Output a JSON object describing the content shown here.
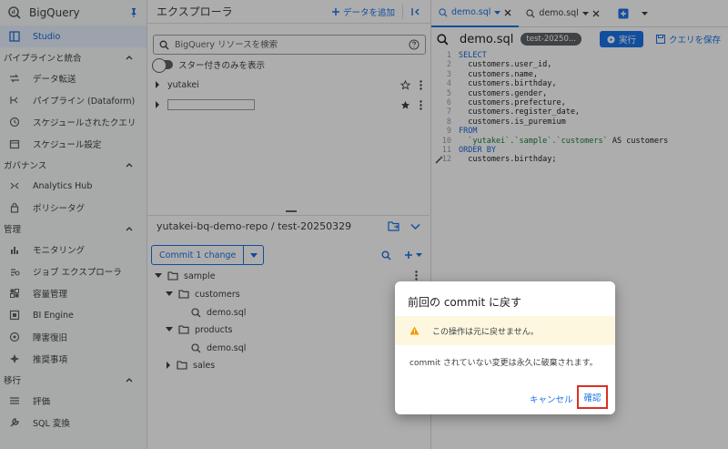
{
  "app": {
    "name": "BigQuery"
  },
  "left_nav": {
    "studio": "Studio",
    "sections": [
      {
        "title": "パイプラインと統合",
        "items": [
          "データ転送",
          "パイプライン (Dataform)",
          "スケジュールされたクエリ",
          "スケジュール設定"
        ]
      },
      {
        "title": "ガバナンス",
        "items": [
          "Analytics Hub",
          "ポリシータグ"
        ]
      },
      {
        "title": "管理",
        "items": [
          "モニタリング",
          "ジョブ エクスプローラ",
          "容量管理",
          "BI Engine",
          "障害復旧",
          "推奨事項"
        ]
      },
      {
        "title": "移行",
        "items": [
          "評価",
          "SQL 変換"
        ]
      }
    ]
  },
  "explorer": {
    "title": "エクスプローラ",
    "add_data": "データを追加",
    "search_placeholder": "BigQuery リソースを検索",
    "starred_only": "スター付きのみを表示",
    "projects": [
      "yutakei",
      ""
    ]
  },
  "repo": {
    "title": "yutakei-bq-demo-repo / test-20250329",
    "commit_button": "Commit 1 change",
    "tree": [
      {
        "label": "sample",
        "type": "folder"
      },
      {
        "label": "customers",
        "type": "folder"
      },
      {
        "label": "demo.sql",
        "type": "file"
      },
      {
        "label": "products",
        "type": "folder"
      },
      {
        "label": "demo.sql",
        "type": "file"
      },
      {
        "label": "sales",
        "type": "folder"
      }
    ]
  },
  "editor": {
    "tabs": [
      "demo.sql",
      "demo.sql"
    ],
    "query_name": "demo.sql",
    "branch_badge": "test-20250...",
    "run": "実行",
    "save": "クエリを保存",
    "lines": [
      {
        "n": "1",
        "parts": [
          {
            "t": "SELECT",
            "c": "kw"
          }
        ]
      },
      {
        "n": "2",
        "parts": [
          {
            "t": "  customers.user_id,",
            "c": ""
          }
        ]
      },
      {
        "n": "3",
        "parts": [
          {
            "t": "  customers.name,",
            "c": ""
          }
        ]
      },
      {
        "n": "4",
        "parts": [
          {
            "t": "  customers.birthday,",
            "c": ""
          }
        ]
      },
      {
        "n": "5",
        "parts": [
          {
            "t": "  customers.gender,",
            "c": ""
          }
        ]
      },
      {
        "n": "6",
        "parts": [
          {
            "t": "  customers.prefecture,",
            "c": ""
          }
        ]
      },
      {
        "n": "7",
        "parts": [
          {
            "t": "  customers.register_date,",
            "c": ""
          }
        ]
      },
      {
        "n": "8",
        "parts": [
          {
            "t": "  customers.is_puremium",
            "c": ""
          }
        ]
      },
      {
        "n": "9",
        "parts": [
          {
            "t": "FROM",
            "c": "kw"
          }
        ]
      },
      {
        "n": "10",
        "parts": [
          {
            "t": "  `yutakei`.`sample`.`customers`",
            "c": "str"
          },
          {
            "t": " AS customers",
            "c": ""
          }
        ]
      },
      {
        "n": "11",
        "parts": [
          {
            "t": "ORDER BY",
            "c": "kw"
          }
        ]
      },
      {
        "n": "12",
        "parts": [
          {
            "t": "  customers.birthday;",
            "c": ""
          }
        ]
      }
    ]
  },
  "dialog": {
    "title": "前回の commit に戻す",
    "warning": "この操作は元に戻せません。",
    "message": "commit されていない変更は永久に破棄されます。",
    "cancel": "キャンセル",
    "confirm": "確認"
  },
  "colors": {
    "accent": "#1a73e8",
    "warning_bg": "#fef7e0",
    "warning_icon": "#f29900",
    "highlight": "#d93025"
  }
}
